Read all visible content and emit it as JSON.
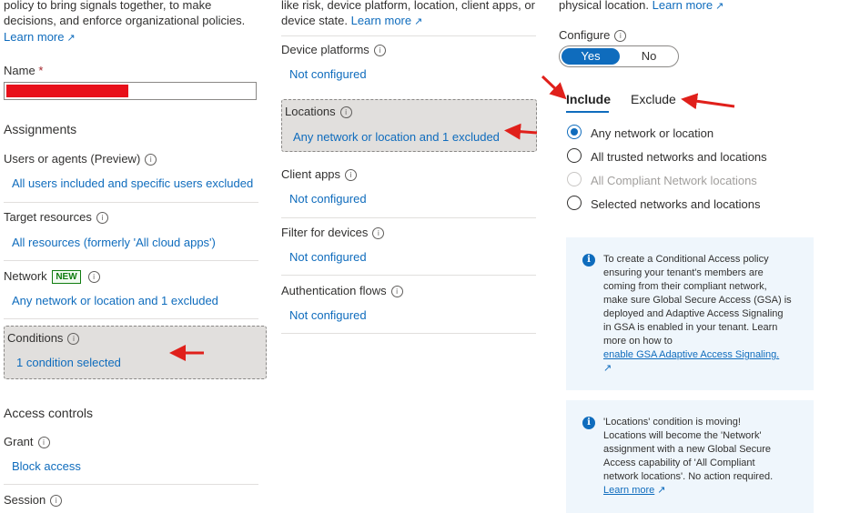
{
  "left": {
    "intro_line1": "policy to bring signals together, to make",
    "intro_line2": "decisions, and enforce organizational policies.",
    "learn_more": "Learn more",
    "name_label": "Name",
    "name_required": "*",
    "assignments_heading": "Assignments",
    "users_label": "Users or agents (Preview)",
    "users_value": "All users included and specific users excluded",
    "target_label": "Target resources",
    "target_value": "All resources (formerly 'All cloud apps')",
    "network_label": "Network",
    "network_badge": "NEW",
    "network_value": "Any network or location and 1 excluded",
    "conditions_label": "Conditions",
    "conditions_value": "1 condition selected",
    "access_heading": "Access controls",
    "grant_label": "Grant",
    "grant_value": "Block access",
    "session_label": "Session"
  },
  "middle": {
    "intro_line1": "like risk, device platform, location, client apps, or",
    "intro_line2": "device state.",
    "learn_more": "Learn more",
    "device_platforms_label": "Device platforms",
    "device_platforms_value": "Not configured",
    "locations_label": "Locations",
    "locations_value": "Any network or location and 1 excluded",
    "client_apps_label": "Client apps",
    "client_apps_value": "Not configured",
    "filter_label": "Filter for devices",
    "filter_value": "Not configured",
    "auth_flows_label": "Authentication flows",
    "auth_flows_value": "Not configured"
  },
  "right": {
    "intro": "physical location.",
    "learn_more": "Learn more",
    "configure_label": "Configure",
    "toggle_yes": "Yes",
    "toggle_no": "No",
    "tab_include": "Include",
    "tab_exclude": "Exclude",
    "radio_options": [
      "Any network or location",
      "All trusted networks and locations",
      "All Compliant Network locations",
      "Selected networks and locations"
    ],
    "info1_lines": [
      "To create a Conditional Access policy",
      "ensuring your tenant's members are",
      "coming from their compliant network,",
      "make sure Global Secure Access (GSA) is",
      "deployed and Adaptive Access Signaling",
      "in GSA is enabled in your tenant. Learn",
      "more on how to"
    ],
    "info1_link": "enable GSA Adaptive Access Signaling.",
    "info2_lines": [
      "'Locations' condition is moving!",
      "Locations will become the 'Network'",
      "assignment with a new Global Secure",
      "Access capability of 'All Compliant",
      "network locations'. No action required."
    ],
    "info2_link": "Learn more"
  },
  "colors": {
    "accent": "#0f6cbd",
    "annotation_arrow": "#e0201b",
    "selected_bg": "#e1dfdd",
    "info_bg": "#eff6fc",
    "badge_green": "#107c10"
  }
}
